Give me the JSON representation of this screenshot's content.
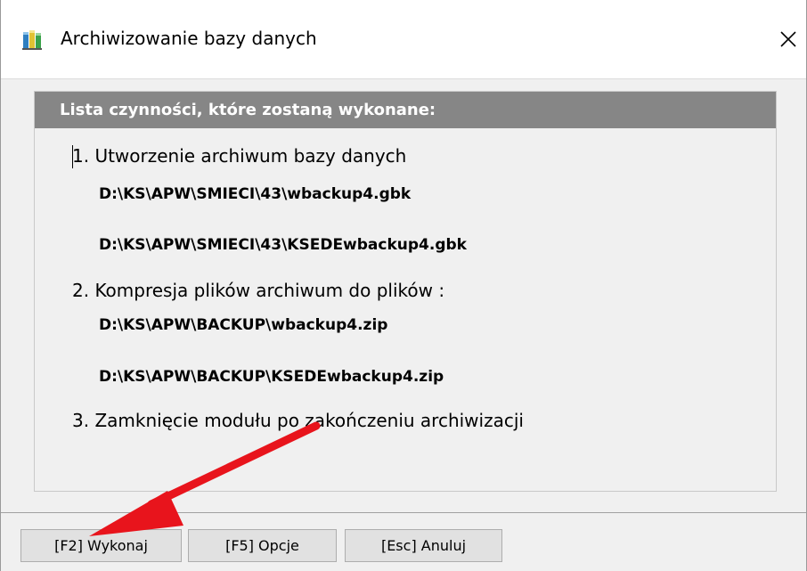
{
  "window": {
    "title": "Archiwizowanie bazy danych",
    "close_symbol": "✕",
    "icon": "database-app-icon"
  },
  "panel": {
    "header": "Lista czynności, które zostaną wykonane:",
    "steps": [
      {
        "label": "1. Utworzenie archiwum bazy danych",
        "paths": [
          "D:\\KS\\APW\\SMIECI\\43\\wbackup4.gbk",
          "D:\\KS\\APW\\SMIECI\\43\\KSEDEwbackup4.gbk"
        ]
      },
      {
        "label": "2. Kompresja plików archiwum do plików :",
        "paths": [
          "D:\\KS\\APW\\BACKUP\\wbackup4.zip",
          "D:\\KS\\APW\\BACKUP\\KSEDEwbackup4.zip"
        ]
      },
      {
        "label": "3. Zamknięcie modułu po zakończeniu archiwizacji",
        "paths": []
      }
    ]
  },
  "buttons": {
    "execute": "[F2] Wykonaj",
    "options": "[F5] Opcje",
    "cancel": "[Esc] Anuluj"
  },
  "annotation": {
    "arrow_color": "#e8141c"
  }
}
